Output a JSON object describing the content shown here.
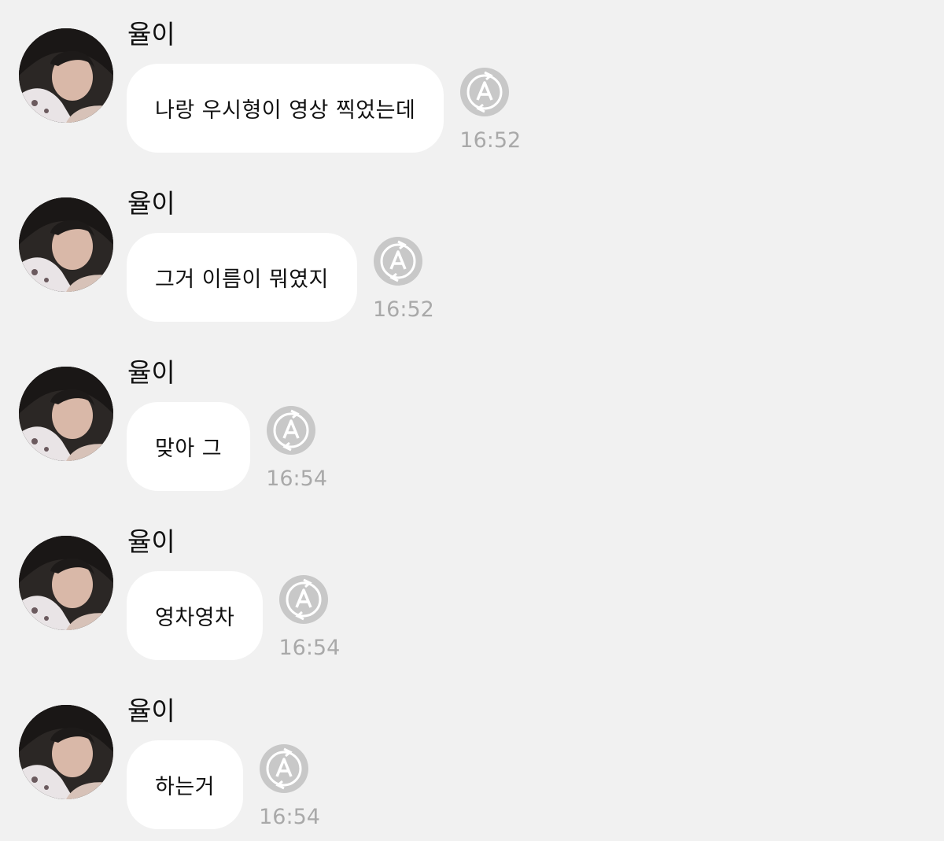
{
  "messages": [
    {
      "sender": "율이",
      "text": "나랑 우시형이 영상 찍었는데",
      "time": "16:52"
    },
    {
      "sender": "율이",
      "text": "그거 이름이 뭐였지",
      "time": "16:52"
    },
    {
      "sender": "율이",
      "text": "맞아 그",
      "time": "16:54"
    },
    {
      "sender": "율이",
      "text": "영차영차",
      "time": "16:54"
    },
    {
      "sender": "율이",
      "text": "하는거",
      "time": "16:54"
    }
  ],
  "icons": {
    "translate": "translate-icon",
    "avatar": "profile-photo"
  },
  "colors": {
    "background": "#f1f1f1",
    "bubble": "#ffffff",
    "timestamp": "#a9a9a9",
    "translate_icon": "#c8c8c8"
  }
}
